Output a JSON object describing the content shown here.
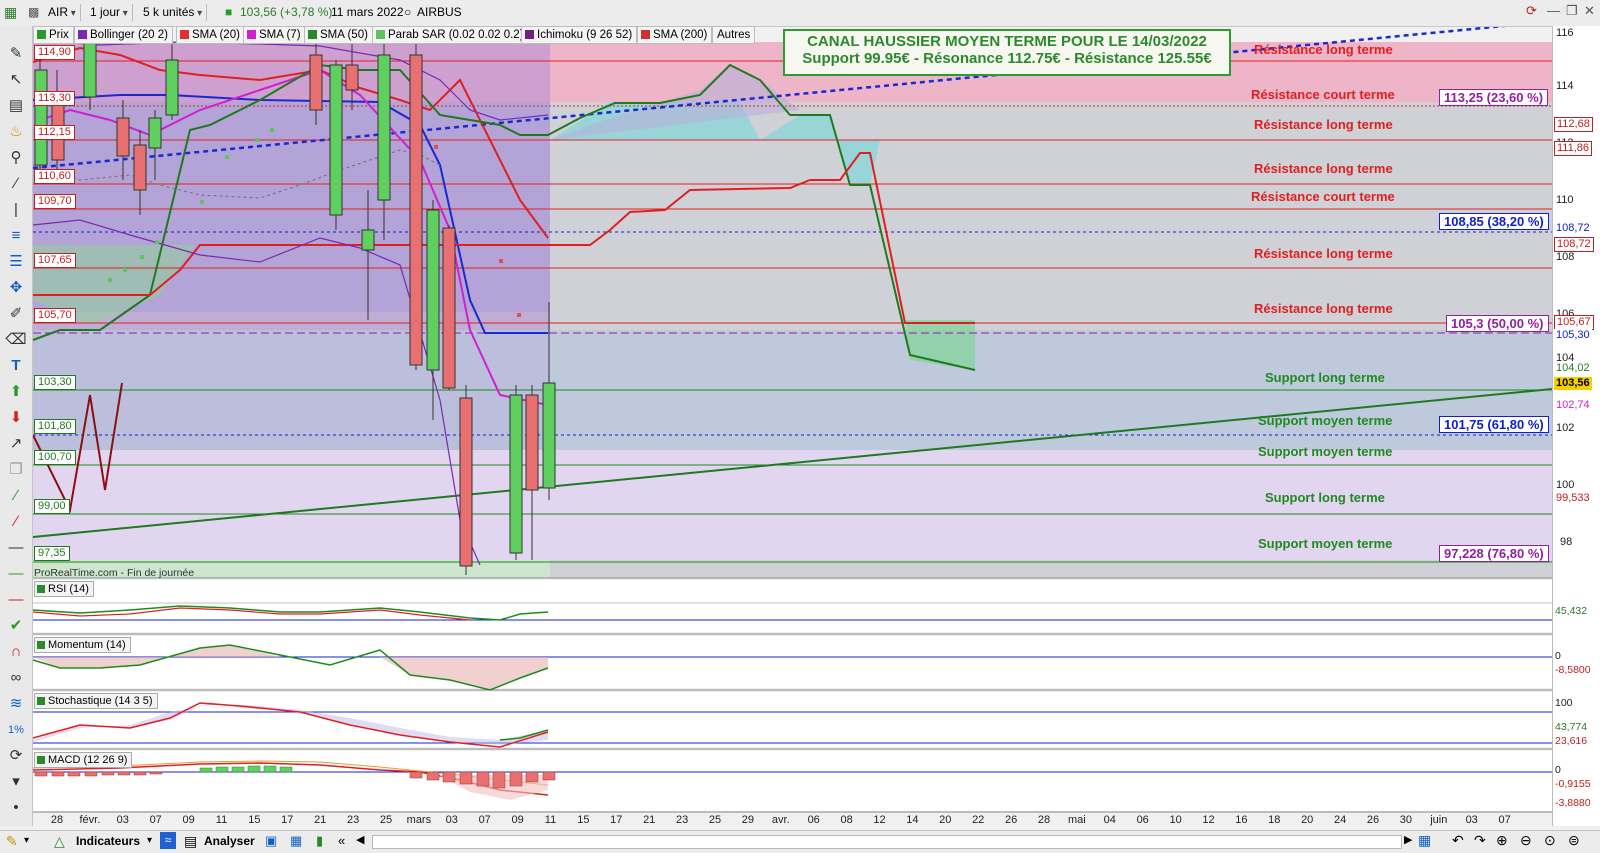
{
  "toolbar": {
    "symbol": "AIR",
    "period": "1 jour",
    "units": "5 k unités",
    "quote": "103,56 (+3,78 %)",
    "date": "11 mars 2022",
    "instrument": "AIRBUS"
  },
  "indicators": [
    {
      "label": "Prix",
      "color": "#2a9a2a"
    },
    {
      "label": "Bollinger (20 2)",
      "color": "#7a2ab0"
    },
    {
      "label": "SMA (20)",
      "color": "#e03030"
    },
    {
      "label": "SMA (7)",
      "color": "#d020d0"
    },
    {
      "label": "SMA (50)",
      "color": "#2a8a2a"
    },
    {
      "label": "Parab SAR (0.02 0.02 0.2)",
      "color": "#60c060"
    },
    {
      "label": "Ichimoku (9 26 52)",
      "color": "#702080"
    },
    {
      "label": "SMA (200)",
      "color": "#d03030"
    },
    {
      "label": "Autres",
      "color": ""
    }
  ],
  "banner": {
    "line1": "CANAL HAUSSIER MOYEN TERME POUR LE 14/03/2022",
    "line2": "Support 99.95€ - Résonance 112.75€ - Résistance 125.55€"
  },
  "left_levels": [
    "114,90",
    "113,30",
    "112,15",
    "110,60",
    "109,70",
    "107,65",
    "105,70",
    "103,30",
    "101,80",
    "100,70",
    "99,00",
    "97,35"
  ],
  "zone_labels": [
    {
      "text": "Résistance long terme",
      "type": "res"
    },
    {
      "text": "Résistance court terme",
      "type": "res"
    },
    {
      "text": "Résistance long terme",
      "type": "res"
    },
    {
      "text": "Résistance long terme",
      "type": "res"
    },
    {
      "text": "Résistance court terme",
      "type": "res"
    },
    {
      "text": "Résistance long terme",
      "type": "res"
    },
    {
      "text": "Résistance long terme",
      "type": "res"
    },
    {
      "text": "Support long terme",
      "type": "sup"
    },
    {
      "text": "Support moyen terme",
      "type": "sup"
    },
    {
      "text": "Support moyen terme",
      "type": "sup"
    },
    {
      "text": "Support long terme",
      "type": "sup"
    },
    {
      "text": "Support moyen terme",
      "type": "sup"
    }
  ],
  "fib_labels": [
    {
      "text": "113,25 (23,60 %)",
      "color": "#9020a0"
    },
    {
      "text": "108,85 (38,20 %)",
      "color": "#1020d0"
    },
    {
      "text": "105,3 (50,00 %)",
      "color": "#9020a0"
    },
    {
      "text": "101,75 (61,80 %)",
      "color": "#1020d0"
    },
    {
      "text": "97,228 (76,80 %)",
      "color": "#9020a0"
    }
  ],
  "right_axis_ticks": [
    "116",
    "114",
    "112",
    "110",
    "108",
    "106",
    "104",
    "102",
    "100",
    "98"
  ],
  "right_levels": [
    {
      "text": "112,68",
      "color": "#c02020"
    },
    {
      "text": "111,86",
      "color": "#c02020"
    },
    {
      "text": "108,72",
      "color": "#1020d0"
    },
    {
      "text": "108,72",
      "color": "#c02020"
    },
    {
      "text": "105,67",
      "color": "#c02020"
    },
    {
      "text": "105,30",
      "color": "#1020d0"
    },
    {
      "text": "104,02",
      "color": "#2a7a2a"
    },
    {
      "text": "103,56",
      "color": "#000000"
    },
    {
      "text": "102,74",
      "color": "#d020d0"
    },
    {
      "text": "99,533",
      "color": "#c02020"
    }
  ],
  "source": "ProRealTime.com - Fin de journée",
  "panels": [
    {
      "label": "RSI (14)",
      "values": [
        "45,432"
      ]
    },
    {
      "label": "Momentum (14)",
      "values": [
        "0",
        "-8,5800"
      ]
    },
    {
      "label": "Stochastique (14 3 5)",
      "values": [
        "100",
        "43,774",
        "23,616"
      ]
    },
    {
      "label": "MACD (12 26 9)",
      "values": [
        "0",
        "-0,9155",
        "-3,8880"
      ]
    }
  ],
  "x_axis": [
    "28",
    "févr.",
    "03",
    "07",
    "09",
    "11",
    "15",
    "17",
    "21",
    "23",
    "25",
    "mars",
    "03",
    "07",
    "09",
    "11",
    "15",
    "17",
    "21",
    "23",
    "25",
    "29",
    "avr.",
    "06",
    "08",
    "12",
    "14",
    "20",
    "22",
    "26",
    "28",
    "mai",
    "04",
    "06",
    "10",
    "12",
    "16",
    "18",
    "20",
    "24",
    "26",
    "30",
    "juin",
    "03",
    "07"
  ],
  "bottom": {
    "indicators_btn": "Indicateurs",
    "analyser_btn": "Analyser"
  },
  "colors": {
    "resistance": "#e02020",
    "support": "#1f8a1f",
    "fib_blue": "#1020d0",
    "fib_purple": "#9020a0"
  }
}
